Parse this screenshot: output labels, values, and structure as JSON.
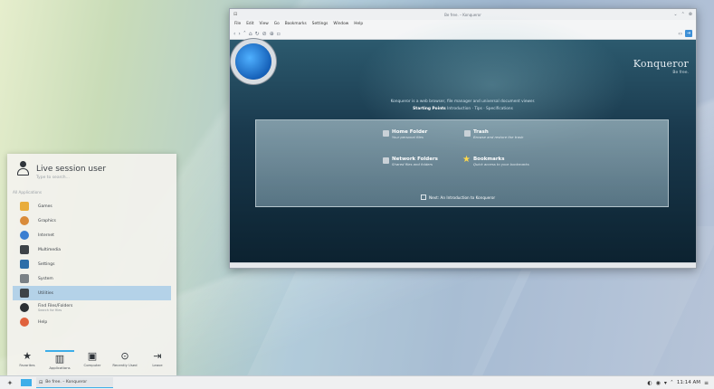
{
  "browser": {
    "title": "Be free. – Konqueror",
    "menu": [
      "File",
      "Edit",
      "View",
      "Go",
      "Bookmarks",
      "Settings",
      "Window",
      "Help"
    ],
    "brand_name": "Konqueror",
    "brand_tagline": "Be free.",
    "intro_text": "Konqueror is a web browser, file manager and universal document viewer.",
    "starting_points": "Starting Points",
    "nav_links": "Introduction · Tips · Specifications",
    "entries": [
      {
        "title": "Home Folder",
        "desc": "Your personal files"
      },
      {
        "title": "Trash",
        "desc": "Browse and restore the trash"
      },
      {
        "title": "Network Folders",
        "desc": "Shared files and folders"
      },
      {
        "title": "Bookmarks",
        "desc": "Quick access to your bookmarks"
      }
    ],
    "intro_link": "Next: An Introduction to Konqueror"
  },
  "launcher": {
    "user_name": "Live session user",
    "search_placeholder": "Type to search...",
    "section_label": "All Applications",
    "apps": [
      {
        "label": "Games",
        "icon": "games-icon",
        "color": "#e9ad3c"
      },
      {
        "label": "Graphics",
        "icon": "graphics-icon",
        "color": "#d98b3a"
      },
      {
        "label": "Internet",
        "icon": "internet-icon",
        "color": "#3b7fd1"
      },
      {
        "label": "Multimedia",
        "icon": "multimedia-icon",
        "color": "#3d4348"
      },
      {
        "label": "Settings",
        "icon": "settings-icon",
        "color": "#2d6ea8"
      },
      {
        "label": "System",
        "icon": "system-icon",
        "color": "#7a8186"
      },
      {
        "label": "Utilities",
        "icon": "utilities-icon",
        "color": "#3d4348"
      },
      {
        "label": "Find Files/Folders",
        "sub": "Search for files",
        "icon": "find-icon",
        "color": "#2b2f33"
      },
      {
        "label": "Help",
        "icon": "help-icon",
        "color": "#e0623d"
      }
    ],
    "tabs": [
      {
        "label": "Favorites",
        "glyph": "★"
      },
      {
        "label": "Applications",
        "glyph": "🏛"
      },
      {
        "label": "Computer",
        "glyph": "🖳"
      },
      {
        "label": "Recently Used",
        "glyph": "⊙"
      },
      {
        "label": "Leave",
        "glyph": "⇥"
      }
    ]
  },
  "taskbar": {
    "task_title": "Be free. – Konqueror",
    "clock": "11:14 AM"
  }
}
